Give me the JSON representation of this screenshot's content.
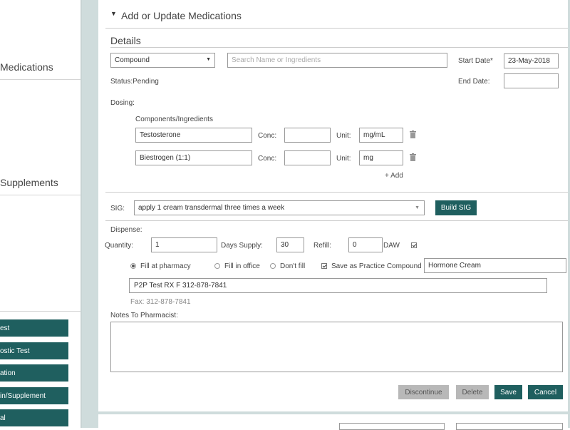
{
  "sidebar": {
    "medications_label": "Medications",
    "supplements_label": "Supplements",
    "buttons": [
      "est",
      "ostic Test",
      "ation",
      "in/Supplement",
      "al"
    ]
  },
  "form": {
    "header_title": "Add or Update Medications",
    "details_title": "Details",
    "type_select": "Compound",
    "search_placeholder": "Search Name or Ingredients",
    "start_date_label": "Start Date*",
    "start_date_value": "23-May-2018",
    "end_date_label": "End Date:",
    "end_date_value": "",
    "status_text": "Status:Pending",
    "dosing_label": "Dosing:",
    "components_label": "Components/Ingredients",
    "components": [
      {
        "name": "Testosterone",
        "conc_label": "Conc:",
        "conc": "",
        "unit_label": "Unit:",
        "unit": "mg/mL"
      },
      {
        "name": "Biestrogen (1:1)",
        "conc_label": "Conc:",
        "conc": "",
        "unit_label": "Unit:",
        "unit": "mg"
      }
    ],
    "add_link": "+ Add",
    "sig_label": "SIG:",
    "sig_value": "apply 1 cream transdermal three times a week",
    "build_sig": "Build SIG",
    "dispense_label": "Dispense:",
    "quantity_label": "Quantity:",
    "quantity_value": "1",
    "days_supply_label": "Days Supply:",
    "days_supply_value": "30",
    "refill_label": "Refill:",
    "refill_value": "0",
    "daw_label": "DAW",
    "daw_checked": true,
    "fill_options": [
      {
        "label": "Fill at pharmacy",
        "selected": true
      },
      {
        "label": "Fill in office",
        "selected": false
      },
      {
        "label": "Don't fill",
        "selected": false
      }
    ],
    "save_practice_label": "Save as Practice Compound",
    "save_practice_checked": true,
    "practice_compound_name": "Hormone Cream",
    "pharmacy_value": "P2P Test RX  F 312-878-7841",
    "fax_text": "Fax: 312-878-7841",
    "notes_label": "Notes To Pharmacist:",
    "notes_value": "",
    "actions": {
      "discontinue": "Discontinue",
      "delete": "Delete",
      "save": "Save",
      "cancel": "Cancel"
    }
  },
  "colors": {
    "accent": "#1f5f5f",
    "gutter": "#cfdcdc",
    "disabled": "#b8b8b8"
  }
}
